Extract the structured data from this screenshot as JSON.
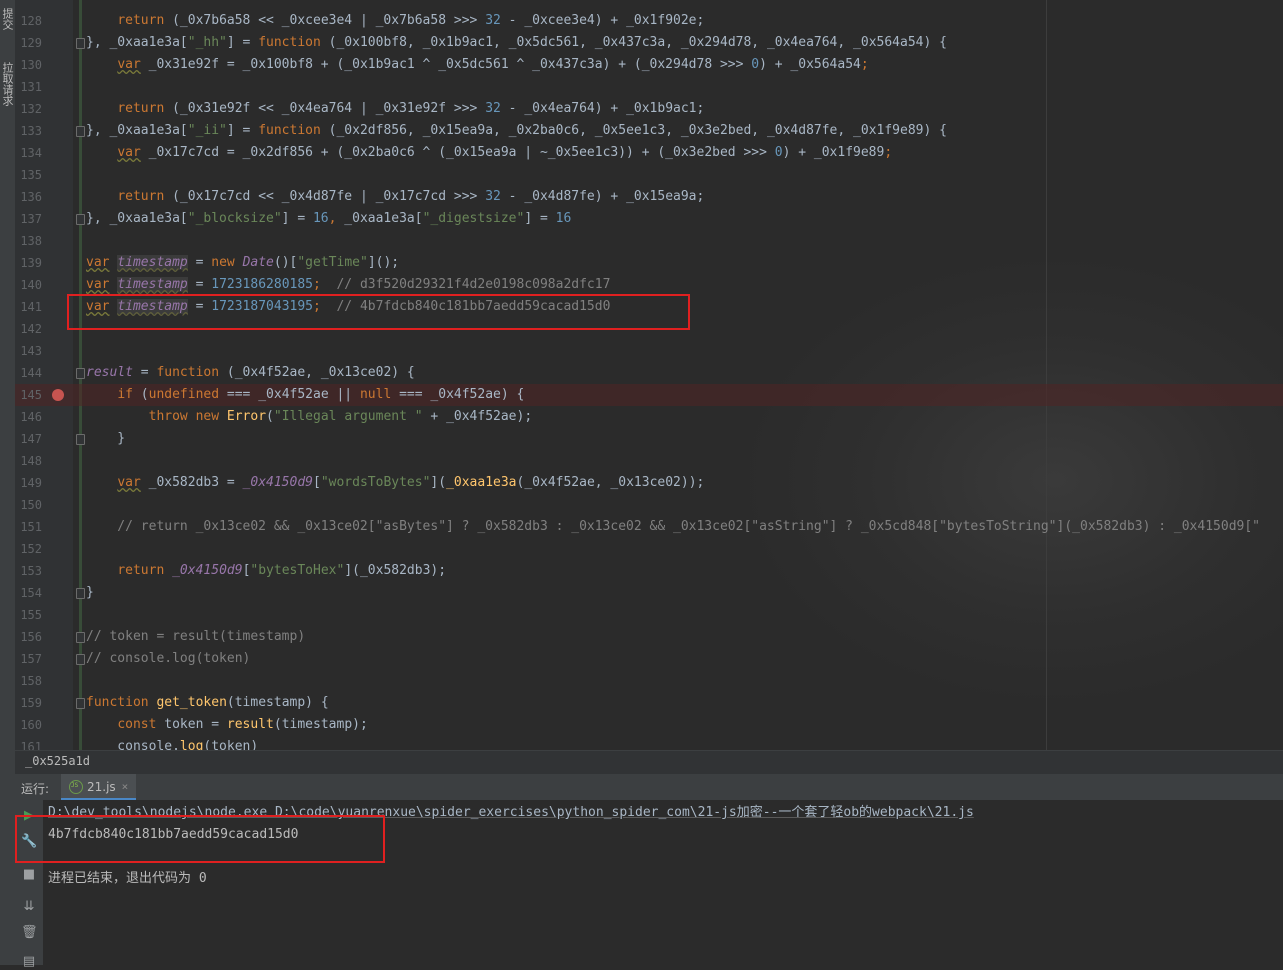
{
  "left_strip": {
    "tabs": [
      "提交",
      "拉取请求"
    ]
  },
  "editor": {
    "lines": [
      {
        "n": "128",
        "tokens": [
          [
            "",
            "    "
          ],
          [
            "kw",
            "return"
          ],
          [
            "",
            " (_0x7b6a58 << _0xcee3e4 | _0x7b6a58 >>> "
          ],
          [
            "num",
            "32"
          ],
          [
            "",
            " - _0xcee3e4) + _0x1f902e;"
          ]
        ]
      },
      {
        "n": "129",
        "fold": true,
        "tokens": [
          [
            "",
            "}, _0xaa1e3a["
          ],
          [
            "str",
            "\"_hh\""
          ],
          [
            "",
            "] = "
          ],
          [
            "kw",
            "function"
          ],
          [
            "",
            " (_0x100bf8, _0x1b9ac1, _0x5dc561, _0x437c3a, _0x294d78, _0x4ea764, _0x564a54) {"
          ]
        ]
      },
      {
        "n": "130",
        "tokens": [
          [
            "",
            "    "
          ],
          [
            "varwarn",
            "var"
          ],
          [
            "",
            " _0x31e92f = _0x100bf8 + (_0x1b9ac1 ^ _0x5dc561 ^ _0x437c3a) + (_0x294d78 >>> "
          ],
          [
            "num",
            "0"
          ],
          [
            "",
            ") + _0x564a54"
          ],
          [
            "kw",
            ";"
          ]
        ]
      },
      {
        "n": "131",
        "tokens": []
      },
      {
        "n": "132",
        "tokens": [
          [
            "",
            "    "
          ],
          [
            "kw",
            "return"
          ],
          [
            "",
            " (_0x31e92f << _0x4ea764 | _0x31e92f >>> "
          ],
          [
            "num",
            "32"
          ],
          [
            "",
            " - _0x4ea764) + _0x1b9ac1;"
          ]
        ]
      },
      {
        "n": "133",
        "fold": true,
        "tokens": [
          [
            "",
            "}, _0xaa1e3a["
          ],
          [
            "str",
            "\"_ii\""
          ],
          [
            "",
            "] = "
          ],
          [
            "kw",
            "function"
          ],
          [
            "",
            " (_0x2df856, _0x15ea9a, _0x2ba0c6, _0x5ee1c3, _0x3e2bed, _0x4d87fe, _0x1f9e89) {"
          ]
        ]
      },
      {
        "n": "134",
        "tokens": [
          [
            "",
            "    "
          ],
          [
            "varwarn",
            "var"
          ],
          [
            "",
            " _0x17c7cd = _0x2df856 + (_0x2ba0c6 ^ (_0x15ea9a | ~_0x5ee1c3)) + (_0x3e2bed >>> "
          ],
          [
            "num",
            "0"
          ],
          [
            "",
            ") + _0x1f9e89"
          ],
          [
            "kw",
            ";"
          ]
        ]
      },
      {
        "n": "135",
        "tokens": []
      },
      {
        "n": "136",
        "tokens": [
          [
            "",
            "    "
          ],
          [
            "kw",
            "return"
          ],
          [
            "",
            " (_0x17c7cd << _0x4d87fe | _0x17c7cd >>> "
          ],
          [
            "num",
            "32"
          ],
          [
            "",
            " - _0x4d87fe) + _0x15ea9a;"
          ]
        ]
      },
      {
        "n": "137",
        "fold": true,
        "tokens": [
          [
            "",
            "}, _0xaa1e3a["
          ],
          [
            "str",
            "\"_blocksize\""
          ],
          [
            "",
            "] = "
          ],
          [
            "num",
            "16"
          ],
          [
            "kw",
            ","
          ],
          [
            "",
            " _0xaa1e3a["
          ],
          [
            "str",
            "\"_digestsize\""
          ],
          [
            "",
            "] = "
          ],
          [
            "num",
            "16"
          ]
        ]
      },
      {
        "n": "138",
        "tokens": []
      },
      {
        "n": "139",
        "tokens": [
          [
            "varwarn",
            "var"
          ],
          [
            "",
            " "
          ],
          [
            "hl",
            "timestamp"
          ],
          [
            "",
            " = "
          ],
          [
            "kw",
            "new"
          ],
          [
            "",
            " "
          ],
          [
            "glob",
            "Date"
          ],
          [
            "",
            "()["
          ],
          [
            "str",
            "\"getTime\""
          ],
          [
            "",
            "]();"
          ]
        ]
      },
      {
        "n": "140",
        "tokens": [
          [
            "varwarn",
            "var"
          ],
          [
            "",
            " "
          ],
          [
            "hl",
            "timestamp"
          ],
          [
            "",
            " = "
          ],
          [
            "num",
            "1723186280185"
          ],
          [
            "kw",
            ";"
          ],
          [
            "cmt",
            "  // d3f520d29321f4d2e0198c098a2dfc17"
          ]
        ]
      },
      {
        "n": "141",
        "tokens": [
          [
            "varwarn",
            "var"
          ],
          [
            "",
            " "
          ],
          [
            "hl",
            "timestamp"
          ],
          [
            "",
            " = "
          ],
          [
            "num",
            "1723187043195"
          ],
          [
            "kw",
            ";"
          ],
          [
            "cmt",
            "  // 4b7fdcb840c181bb7aedd59cacad15d0"
          ]
        ]
      },
      {
        "n": "142",
        "tokens": []
      },
      {
        "n": "143",
        "tokens": []
      },
      {
        "n": "144",
        "fold": true,
        "tokens": [
          [
            "glob",
            "result"
          ],
          [
            "",
            " = "
          ],
          [
            "kw",
            "function"
          ],
          [
            "",
            " (_0x4f52ae, _0x13ce02) {"
          ]
        ]
      },
      {
        "n": "145",
        "bp": true,
        "tokens": [
          [
            "",
            "    "
          ],
          [
            "kw",
            "if"
          ],
          [
            "",
            " ("
          ],
          [
            "kw",
            "undefined"
          ],
          [
            "",
            " === _0x4f52ae || "
          ],
          [
            "kw",
            "null"
          ],
          [
            "",
            " === _0x4f52ae) {"
          ]
        ]
      },
      {
        "n": "146",
        "tokens": [
          [
            "",
            "        "
          ],
          [
            "kw",
            "throw new"
          ],
          [
            "",
            " "
          ],
          [
            "fn",
            "Error"
          ],
          [
            "",
            "("
          ],
          [
            "str",
            "\"Illegal argument \""
          ],
          [
            "",
            " + _0x4f52ae);"
          ]
        ]
      },
      {
        "n": "147",
        "fold": true,
        "tokens": [
          [
            "",
            "    }"
          ]
        ]
      },
      {
        "n": "148",
        "tokens": []
      },
      {
        "n": "149",
        "tokens": [
          [
            "",
            "    "
          ],
          [
            "varwarn",
            "var"
          ],
          [
            "",
            " _0x582db3 = "
          ],
          [
            "glob",
            "_0x4150d9"
          ],
          [
            "",
            "["
          ],
          [
            "str",
            "\"wordsToBytes\""
          ],
          [
            "",
            "]("
          ],
          [
            "fn",
            "_0xaa1e3a"
          ],
          [
            "",
            "(_0x4f52ae, _0x13ce02));"
          ]
        ]
      },
      {
        "n": "150",
        "tokens": []
      },
      {
        "n": "151",
        "tokens": [
          [
            "cmt",
            "    // return _0x13ce02 && _0x13ce02[\"asBytes\"] ? _0x582db3 : _0x13ce02 && _0x13ce02[\"asString\"] ? _0x5cd848[\"bytesToString\"](_0x582db3) : _0x4150d9[\""
          ]
        ]
      },
      {
        "n": "152",
        "tokens": []
      },
      {
        "n": "153",
        "tokens": [
          [
            "",
            "    "
          ],
          [
            "kw",
            "return"
          ],
          [
            "",
            " "
          ],
          [
            "glob",
            "_0x4150d9"
          ],
          [
            "",
            "["
          ],
          [
            "str",
            "\"bytesToHex\""
          ],
          [
            "",
            "](_0x582db3);"
          ]
        ]
      },
      {
        "n": "154",
        "fold": true,
        "tokens": [
          [
            "",
            "}"
          ]
        ]
      },
      {
        "n": "155",
        "tokens": []
      },
      {
        "n": "156",
        "fold": true,
        "tokens": [
          [
            "cmt",
            "// token = result(timestamp)"
          ]
        ]
      },
      {
        "n": "157",
        "fold": true,
        "tokens": [
          [
            "cmt",
            "// console.log(token)"
          ]
        ]
      },
      {
        "n": "158",
        "tokens": []
      },
      {
        "n": "159",
        "fold": true,
        "tokens": [
          [
            "kw",
            "function"
          ],
          [
            "",
            " "
          ],
          [
            "fn",
            "get_token"
          ],
          [
            "",
            "(timestamp) {"
          ]
        ]
      },
      {
        "n": "160",
        "tokens": [
          [
            "",
            "    "
          ],
          [
            "kw",
            "const"
          ],
          [
            "",
            " token = "
          ],
          [
            "fn",
            "result"
          ],
          [
            "",
            "(timestamp);"
          ]
        ]
      },
      {
        "n": "161",
        "tokens": [
          [
            "",
            "    console."
          ],
          [
            "fn",
            "log"
          ],
          [
            "",
            "(token)"
          ]
        ]
      }
    ]
  },
  "breadcrumb": {
    "text": "_0x525a1d"
  },
  "run_panel": {
    "label": "运行:",
    "tab_name": "21.js",
    "tab_close": "×",
    "command": "D:\\dev_tools\\nodejs\\node.exe D:\\code\\yuanrenxue\\spider_exercises\\python_spider_com\\21-js加密--一个套了轻ob的webpack\\21.js",
    "output": "4b7fdcb840c181bb7aedd59cacad15d0",
    "exit_message": "进程已结束，退出代码为 0"
  }
}
